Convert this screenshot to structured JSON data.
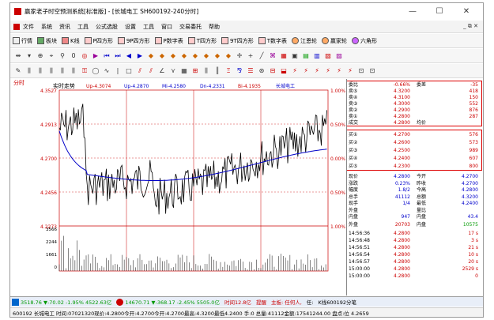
{
  "window": {
    "title": "赢家老子时空预测系统[标准版] - [长城电工  SH600192-240分时]",
    "min": "—",
    "max": "☐",
    "close": "✕"
  },
  "menubar": {
    "items": [
      "文件",
      "系统",
      "资讯",
      "工具",
      "公式选股",
      "设置",
      "工具",
      "窗口",
      "交易委托",
      "帮助"
    ],
    "right": "_ ⧉ ✕"
  },
  "toolbar1": {
    "items": [
      "行情",
      "板块",
      "K线",
      "P四方形",
      "9P四方形",
      "P数字表",
      "T四方形",
      "9T四方形",
      "T数字表",
      "江恩轮",
      "赢家轮",
      "六角形"
    ]
  },
  "side_label": "分时",
  "chart": {
    "title": "实时走势",
    "header_items": [
      {
        "label": "Up-4.3074",
        "color": "#c00"
      },
      {
        "label": "Up-4.2870",
        "color": "#00c"
      },
      {
        "label": "Mi-4.2580",
        "color": "#00c"
      },
      {
        "label": "Dn-4.2331",
        "color": "#00c"
      },
      {
        "label": "Bi-4.1935",
        "color": "#c00"
      },
      {
        "label": "长城电工",
        "color": "#00c"
      }
    ],
    "left_ticks": [
      "4.3527",
      "4.2913",
      "4.2700",
      "4.2456",
      "4.2273"
    ],
    "right_ticks": [
      "1.00%",
      "0.50%",
      "0.00%",
      "0.50%",
      "1.00%"
    ],
    "vol_ticks": [
      "3566",
      "2244",
      "1661",
      "0"
    ]
  },
  "quote": {
    "top": [
      {
        "c1": "委比",
        "v1": "-0.66%",
        "c2": "委差",
        "v2": "-35"
      },
      {
        "c1": "卖⑤",
        "v1": "4.3200",
        "c2": "",
        "v2": "418"
      },
      {
        "c1": "卖④",
        "v1": "4.3100",
        "c2": "",
        "v2": "150"
      },
      {
        "c1": "卖③",
        "v1": "4.3000",
        "c2": "",
        "v2": "552"
      },
      {
        "c1": "卖②",
        "v1": "4.2900",
        "c2": "",
        "v2": "876"
      },
      {
        "c1": "卖①",
        "v1": "4.2800",
        "c2": "",
        "v2": "287"
      },
      {
        "c1": "成交",
        "v1": "4.2800",
        "c2": "均价",
        "v2": ""
      }
    ],
    "buy": [
      {
        "c1": "买①",
        "v1": "4.2700",
        "v2": "576"
      },
      {
        "c1": "买②",
        "v1": "4.2600",
        "v2": "573"
      },
      {
        "c1": "买③",
        "v1": "4.2500",
        "v2": "989"
      },
      {
        "c1": "买④",
        "v1": "4.2400",
        "v2": "607"
      },
      {
        "c1": "买⑤",
        "v1": "4.2300",
        "v2": "800"
      }
    ],
    "stats": [
      {
        "c1": "现价",
        "v1": "4.2800",
        "c2": "今开",
        "v2": "4.2700"
      },
      {
        "c1": "涨跌",
        "v1": "0.23%",
        "c2": "昨收",
        "v2": "4.2700"
      },
      {
        "c1": "幅度",
        "v1": "1.8/2",
        "c2": "今高",
        "v2": "4.2800"
      },
      {
        "c1": "总手",
        "v1": "41112",
        "c2": "总额",
        "v2": "4.3200"
      },
      {
        "c1": "现手",
        "v1": "1/4",
        "c2": "最低",
        "v2": "4.2400"
      },
      {
        "c1": "外盘",
        "v1": "",
        "c2": "量比",
        "v2": ""
      },
      {
        "c1": "内盘",
        "v1": "947",
        "c2": "内盘",
        "v2": "43.4"
      }
    ],
    "ticks_header": {
      "c1": "外盘",
      "v1": "20703",
      "c2": "内盘",
      "v2": "10575"
    },
    "ticks": [
      {
        "t": "14:56:36",
        "p": "4.2800",
        "v": "17 s"
      },
      {
        "t": "14:56:48",
        "p": "4.2800",
        "v": "3 s"
      },
      {
        "t": "14:56:51",
        "p": "4.2800",
        "v": "21 s"
      },
      {
        "t": "14:56:54",
        "p": "4.2800",
        "v": "10 s"
      },
      {
        "t": "14:56:57",
        "p": "4.2800",
        "v": "20 s"
      },
      {
        "t": "15:00:00",
        "p": "4.2800",
        "v": "2529 s"
      },
      {
        "t": "15:00:00",
        "p": "4.2800",
        "v": "0"
      }
    ]
  },
  "statusbar": {
    "a": "3518.76 ▼-70.02 -1.95% 4522.63亿",
    "b": "14670.71 ▼-368.17 -2.45% 5505.0亿",
    "c": "时间12.8亿",
    "d": "提醒",
    "e": "主板: 任何人,",
    "f": "任:",
    "g": "K线600192分笔"
  },
  "bottombar": {
    "text": "600192 长城电工 时间:07021320现价:4.2800今开:4.2700今开:4.2700最高:4.3200最低4.2400 手:0 总量:41112金额:17541244.00 盘点:位 4.2659"
  },
  "colors": {
    "price": "#000000",
    "avg": "#0000c8",
    "grid": "#c00000",
    "up": "#c00000",
    "down": "#009900"
  }
}
